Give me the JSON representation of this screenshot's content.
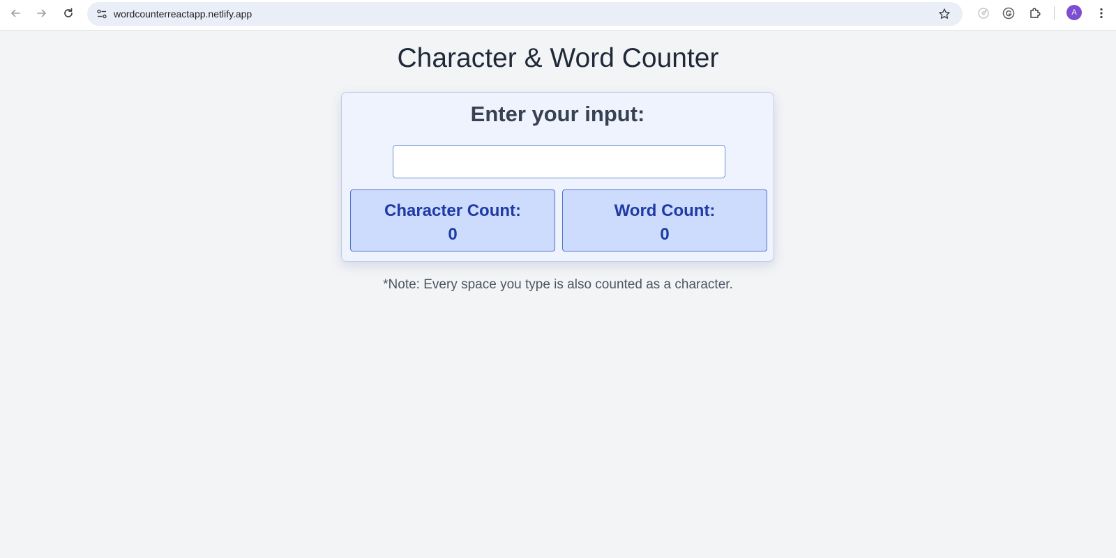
{
  "browser": {
    "url": "wordcounterreactapp.netlify.app",
    "avatar_letter": "A",
    "icons": [
      "back-arrow-icon",
      "forward-arrow-icon",
      "reload-icon",
      "site-settings-icon",
      "star-icon",
      "extension-refresh-icon",
      "grammarly-icon",
      "extensions-puzzle-icon",
      "kebab-menu-icon"
    ]
  },
  "page": {
    "title": "Character & Word Counter",
    "card": {
      "heading": "Enter your input:",
      "input_value": "",
      "character_count": {
        "label": "Character Count:",
        "value": "0"
      },
      "word_count": {
        "label": "Word Count:",
        "value": "0"
      }
    },
    "note": "*Note: Every space you type is also counted as a character."
  },
  "colors": {
    "page_bg": "#f3f4f6",
    "card_bg": "#eef3fd",
    "count_box_bg": "#cddcfd",
    "count_text": "#1e3aa5",
    "avatar_bg": "#7b4fcf"
  }
}
